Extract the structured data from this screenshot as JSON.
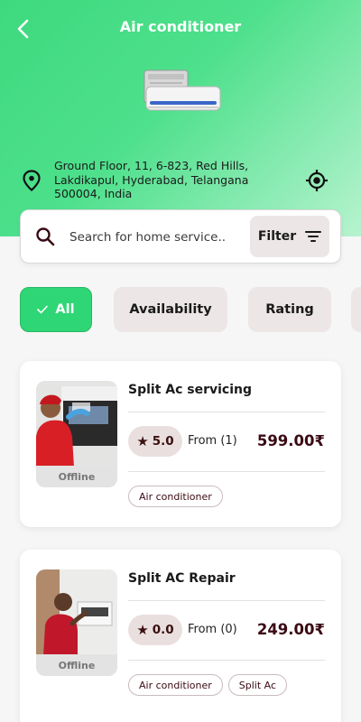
{
  "header": {
    "title": "Air conditioner"
  },
  "location": {
    "address": "Ground Floor, 11, 6-823, Red Hills, Lakdikapul, Hyderabad, Telangana 500004, India"
  },
  "search": {
    "placeholder": "Search for home service...",
    "filter_label": "Filter"
  },
  "filters": [
    {
      "label": "All",
      "selected": true
    },
    {
      "label": "Availability",
      "selected": false
    },
    {
      "label": "Rating",
      "selected": false
    }
  ],
  "services": [
    {
      "title": "Split Ac servicing",
      "status": "Offline",
      "rating": "5.0",
      "from_text": "From (1)",
      "price": "599.00₹",
      "tags": [
        "Air conditioner"
      ]
    },
    {
      "title": "Split AC Repair",
      "status": "Offline",
      "rating": "0.0",
      "from_text": "From (0)",
      "price": "249.00₹",
      "tags": [
        "Air conditioner",
        "Split Ac"
      ]
    }
  ],
  "colors": {
    "accent": "#2fd675",
    "price": "#3b0a14",
    "chip_bg": "#ece6e6"
  },
  "icons": [
    "back-arrow-icon",
    "location-pin-icon",
    "gps-target-icon",
    "search-icon",
    "filter-lines-icon",
    "check-icon",
    "star-icon"
  ]
}
